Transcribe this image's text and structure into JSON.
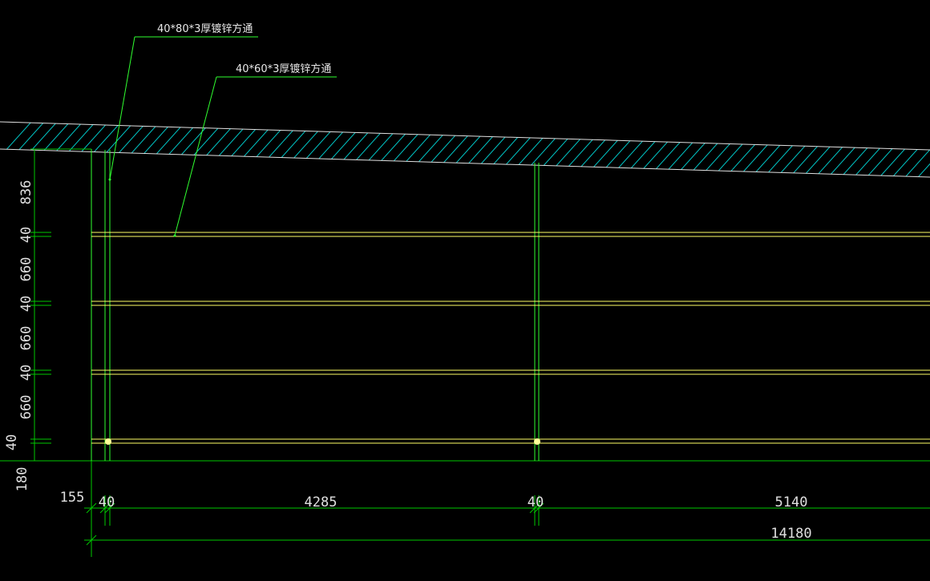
{
  "colors": {
    "background": "#000000",
    "dimension_line": "#00c800",
    "member_line": "#30ff30",
    "rail_line": "#ffff66",
    "hatch": "#00c8c8",
    "text": "#e0e0e0",
    "node": "#ffff99"
  },
  "annotations": [
    {
      "text": "40*80*3厚镀锌方通"
    },
    {
      "text": "40*60*3厚镀锌方通"
    }
  ],
  "vertical_dimensions": [
    "836",
    "40",
    "660",
    "40",
    "660",
    "40",
    "660",
    "40",
    "180"
  ],
  "horizontal_dimensions": {
    "offset": "155",
    "segments": [
      "40",
      "4285",
      "40",
      "5140"
    ],
    "total": "14180"
  }
}
